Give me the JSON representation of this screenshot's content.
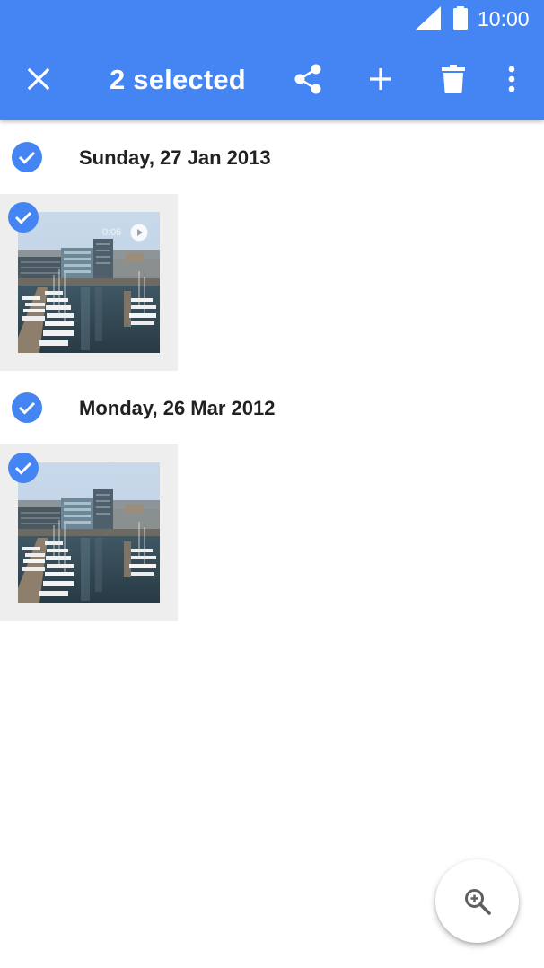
{
  "status_bar": {
    "time": "10:00",
    "icons": [
      "signal-icon",
      "battery-icon"
    ]
  },
  "toolbar": {
    "title": "2 selected",
    "actions": [
      "close-icon",
      "share-icon",
      "add-icon",
      "delete-icon",
      "more-vert-icon"
    ]
  },
  "sections": [
    {
      "date": "Sunday, 27 Jan 2013",
      "selected": true,
      "items": [
        {
          "type": "video",
          "duration": "0:05",
          "selected": true
        }
      ]
    },
    {
      "date": "Monday, 26 Mar 2012",
      "selected": true,
      "items": [
        {
          "type": "photo",
          "selected": true
        }
      ]
    }
  ],
  "fab": {
    "icon": "zoom-in-icon"
  },
  "colors": {
    "primary": "#4585F3",
    "thumbnail_cell": "#EEEEEE",
    "text": "#212121"
  }
}
